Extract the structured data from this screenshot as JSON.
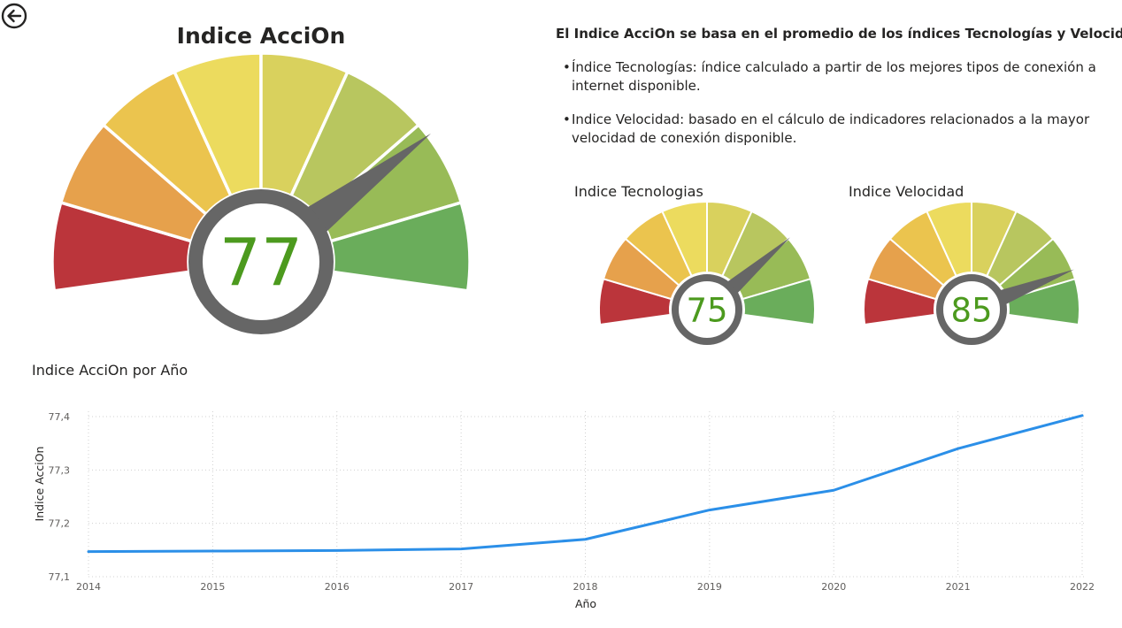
{
  "colors": {
    "segments": [
      "#bb353b",
      "#e6a14c",
      "#ebc44e",
      "#ecdb5e",
      "#d9d15d",
      "#b8c65f",
      "#98bb57",
      "#6aad5b"
    ],
    "needle": "#666666",
    "value_text": "#4c9a1e",
    "line": "#2b8fe8"
  },
  "gauges": {
    "main": {
      "title": "Indice AcciOn",
      "value": 77,
      "display": "77"
    },
    "tecnologias": {
      "title": "Indice Tecnologias",
      "value": 75,
      "display": "75"
    },
    "velocidad": {
      "title": "Indice Velocidad",
      "value": 85,
      "display": "85"
    }
  },
  "info": {
    "heading": "El Indice AcciOn se basa en el promedio de los índices Tecnologías y Velocidad.",
    "bullets": [
      "Índice Tecnologías:  índice calculado a partir de los mejores tipos de conexión a internet disponible.",
      "Indice Velocidad: basado en el cálculo de indicadores relacionados a la mayor velocidad de conexión disponible."
    ]
  },
  "chart_data": {
    "type": "line",
    "title": "Indice AcciOn por Año",
    "xlabel": "Año",
    "ylabel": "Indice AcciOn",
    "x": [
      2014,
      2015,
      2016,
      2017,
      2018,
      2019,
      2020,
      2021,
      2022
    ],
    "series": [
      {
        "values": [
          77.147,
          77.148,
          77.149,
          77.152,
          77.17,
          77.225,
          77.262,
          77.34,
          77.402
        ]
      }
    ],
    "ylim": [
      77.1,
      77.4
    ],
    "yticks": [
      "77,1",
      "77,2",
      "77,3",
      "77,4"
    ],
    "grid": true
  }
}
